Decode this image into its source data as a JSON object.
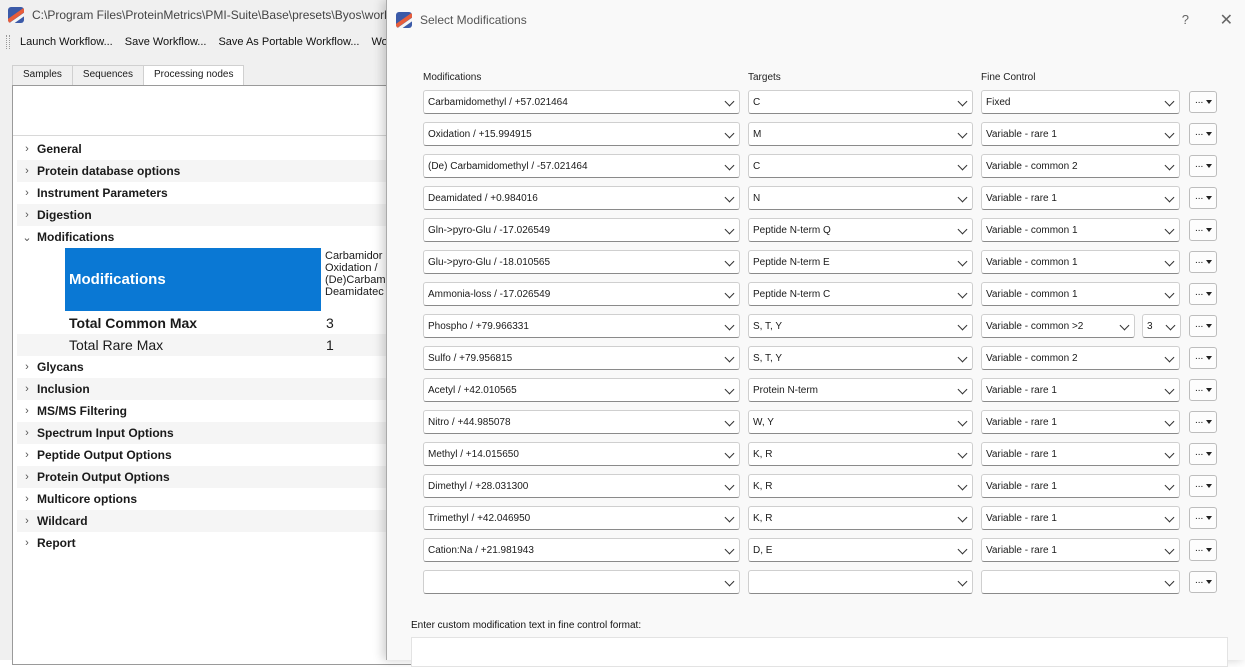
{
  "main_window": {
    "title": "C:\\Program Files\\ProteinMetrics\\PMI-Suite\\Base\\presets\\Byos\\work",
    "toolbar": [
      "Launch Workflow...",
      "Save Workflow...",
      "Save As Portable Workflow...",
      "Workf"
    ],
    "tabs": [
      "Samples",
      "Sequences",
      "Processing nodes"
    ],
    "active_tab": "Processing nodes",
    "tree_before": [
      "General",
      "Protein database options",
      "Instrument Parameters",
      "Digestion"
    ],
    "tree_expanded": "Modifications",
    "modifications_header": "Modifications",
    "modifications_values": [
      "Carbamidor",
      "Oxidation /",
      "(De)Carbam",
      "Deamidatec"
    ],
    "total_common_max_label": "Total Common Max",
    "total_common_max": "3",
    "total_rare_max_label": "Total Rare Max",
    "total_rare_max": "1",
    "tree_after": [
      "Glycans",
      "Inclusion",
      "MS/MS Filtering",
      "Spectrum Input Options",
      "Peptide Output Options",
      "Protein Output Options",
      "Multicore options",
      "Wildcard",
      "Report"
    ]
  },
  "dialog": {
    "title": "Select Modifications",
    "help": "?",
    "close": "✕",
    "col_modifications": "Modifications",
    "col_targets": "Targets",
    "col_fine_control": "Fine Control",
    "more_label": "...",
    "rows": [
      {
        "mod": "Carbamidomethyl / +57.021464",
        "target": "C",
        "fine": "Fixed",
        "extra": ""
      },
      {
        "mod": "Oxidation / +15.994915",
        "target": "M",
        "fine": "Variable - rare 1",
        "extra": ""
      },
      {
        "mod": "(De) Carbamidomethyl / -57.021464",
        "target": "C",
        "fine": "Variable - common 2",
        "extra": ""
      },
      {
        "mod": "Deamidated / +0.984016",
        "target": "N",
        "fine": "Variable - rare 1",
        "extra": ""
      },
      {
        "mod": "Gln->pyro-Glu / -17.026549",
        "target": "Peptide N-term Q",
        "fine": "Variable - common 1",
        "extra": ""
      },
      {
        "mod": "Glu->pyro-Glu / -18.010565",
        "target": "Peptide N-term E",
        "fine": "Variable - common 1",
        "extra": ""
      },
      {
        "mod": "Ammonia-loss / -17.026549",
        "target": "Peptide N-term C",
        "fine": "Variable - common 1",
        "extra": ""
      },
      {
        "mod": "Phospho / +79.966331",
        "target": "S, T, Y",
        "fine": "Variable - common >2",
        "extra": "3"
      },
      {
        "mod": "Sulfo / +79.956815",
        "target": "S, T, Y",
        "fine": "Variable - common 2",
        "extra": ""
      },
      {
        "mod": "Acetyl / +42.010565",
        "target": "Protein N-term",
        "fine": "Variable - rare 1",
        "extra": ""
      },
      {
        "mod": "Nitro / +44.985078",
        "target": "W, Y",
        "fine": "Variable - rare 1",
        "extra": ""
      },
      {
        "mod": "Methyl / +14.015650",
        "target": "K, R",
        "fine": "Variable - rare 1",
        "extra": ""
      },
      {
        "mod": "Dimethyl / +28.031300",
        "target": "K, R",
        "fine": "Variable - rare 1",
        "extra": ""
      },
      {
        "mod": "Trimethyl / +42.046950",
        "target": "K, R",
        "fine": "Variable - rare 1",
        "extra": ""
      },
      {
        "mod": "Cation:Na / +21.981943",
        "target": "D, E",
        "fine": "Variable - rare 1",
        "extra": ""
      },
      {
        "mod": "",
        "target": "",
        "fine": "",
        "extra": ""
      }
    ],
    "custom_label": "Enter custom modification text in fine control format:",
    "custom_value": ""
  }
}
